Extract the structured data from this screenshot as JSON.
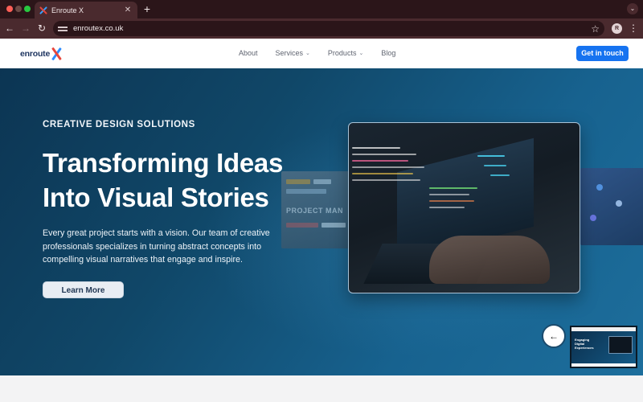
{
  "browser": {
    "tab_title": "Enroute X",
    "tab_close": "✕",
    "new_tab": "+",
    "tab_menu": "⌄",
    "url": "enroutex.co.uk",
    "profile_initial": "R"
  },
  "site": {
    "logo_text": "enroute",
    "nav": [
      {
        "label": "About",
        "has_dropdown": false
      },
      {
        "label": "Services",
        "has_dropdown": true
      },
      {
        "label": "Products",
        "has_dropdown": true
      },
      {
        "label": "Blog",
        "has_dropdown": false
      }
    ],
    "cta_label": "Get in touch"
  },
  "hero": {
    "eyebrow": "CREATIVE DESIGN SOLUTIONS",
    "title_line1": "Transforming Ideas",
    "title_line2": "Into Visual Stories",
    "lede": "Every great project starts with a vision. Our team of creative professionals specializes in turning abstract concepts into compelling visual narratives that engage and inspire.",
    "button_label": "Learn More",
    "bg_card_text": "PROJECT MAN",
    "prev_arrow": "←",
    "thumb_text": "Engaging Digital Experiences"
  },
  "colors": {
    "accent": "#1673f0",
    "hero_start": "#0c3553",
    "hero_end": "#1d6e9c",
    "chrome": "#4a2a2e"
  }
}
